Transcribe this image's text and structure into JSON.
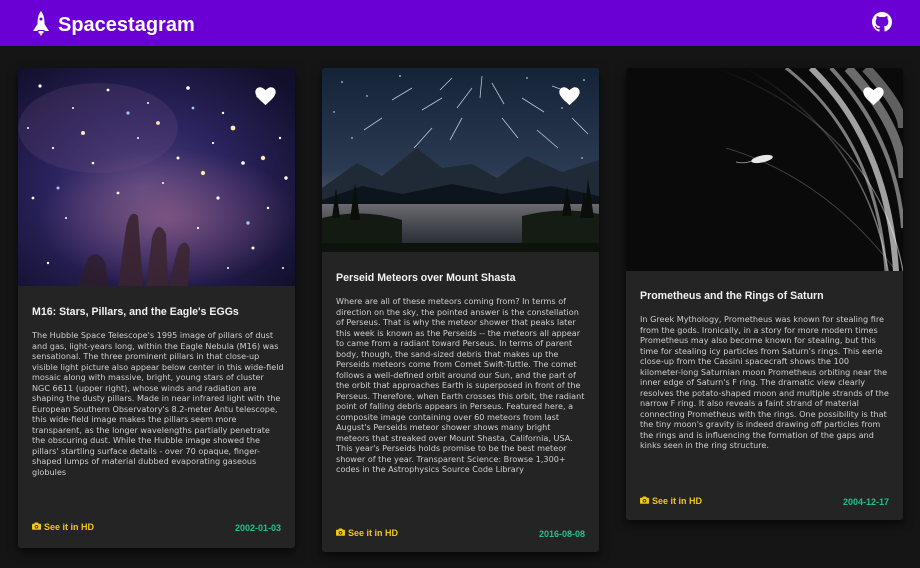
{
  "app": {
    "title": "Spacestagram",
    "logo_icon": "space-shuttle-icon",
    "github_icon": "github-icon"
  },
  "colors": {
    "navbar": "#6a00d4",
    "background": "#151515",
    "card": "#242424",
    "hd_link": "#f0c419",
    "date": "#1fc090"
  },
  "posts": [
    {
      "title": "M16: Stars, Pillars, and the Eagle's EGGs",
      "description": "The Hubble Space Telescope's 1995 image of pillars of dust and gas, light-years long, within the Eagle Nebula (M16) was sensational. The three prominent pillars in that close-up visible light picture also appear below center in this wide-field mosaic along with massive, bright, young stars of cluster NGC 6611 (upper right), whose winds and radiation are shaping the dusty pillars. Made in near infrared light with the European Southern Observatory's 8.2-meter Antu telescope, this wide-field image makes the pillars seem more transparent, as the longer wavelengths partially penetrate the obscuring dust. While the Hubble image showed the pillars' startling surface details - over 70 opaque, finger-shaped lumps of material dubbed evaporating gaseous globules",
      "hd_label": "See it in HD",
      "date": "2002-01-03",
      "liked": false
    },
    {
      "title": "Perseid Meteors over Mount Shasta",
      "description": "Where are all of these meteors coming from? In terms of direction on the sky, the pointed answer is the constellation of Perseus. That is why the meteor shower that peaks later this week is known as the Perseids -- the meteors all appear to came from a radiant toward Perseus. In terms of parent body, though, the sand-sized debris that makes up the Perseids meteors come from Comet Swift-Tuttle. The comet follows a well-defined orbit around our Sun, and the part of the orbit that approaches Earth is superposed in front of the Perseus. Therefore, when Earth crosses this orbit, the radiant point of falling debris appears in Perseus. Featured here, a composite image containing over 60 meteors from last August's Perseids meteor shower shows many bright meteors that streaked over Mount Shasta, California, USA. This year's Perseids holds promise to be the best meteor shower of the year. Transparent Science: Browse 1,300+ codes in the Astrophysics Source Code Library",
      "hd_label": "See it in HD",
      "date": "2016-08-08",
      "liked": false
    },
    {
      "title": "Prometheus and the Rings of Saturn",
      "description": "In Greek Mythology, Prometheus was known for stealing fire from the gods. Ironically, in a story for more modern times Prometheus may also become known for stealing, but this time for stealing icy particles from Saturn's rings. This eerie close-up from the Cassini spacecraft shows the 100 kilometer-long Saturnian moon Prometheus orbiting near the inner edge of Saturn's F ring. The dramatic view clearly resolves the potato-shaped moon and multiple strands of the narrow F ring. It also reveals a faint strand of material connecting Prometheus with the rings. One possibility is that the tiny moon's gravity is indeed drawing off particles from the rings and is influencing the formation of the gaps and kinks seen in the ring structure.",
      "hd_label": "See it in HD",
      "date": "2004-12-17",
      "liked": false
    }
  ]
}
